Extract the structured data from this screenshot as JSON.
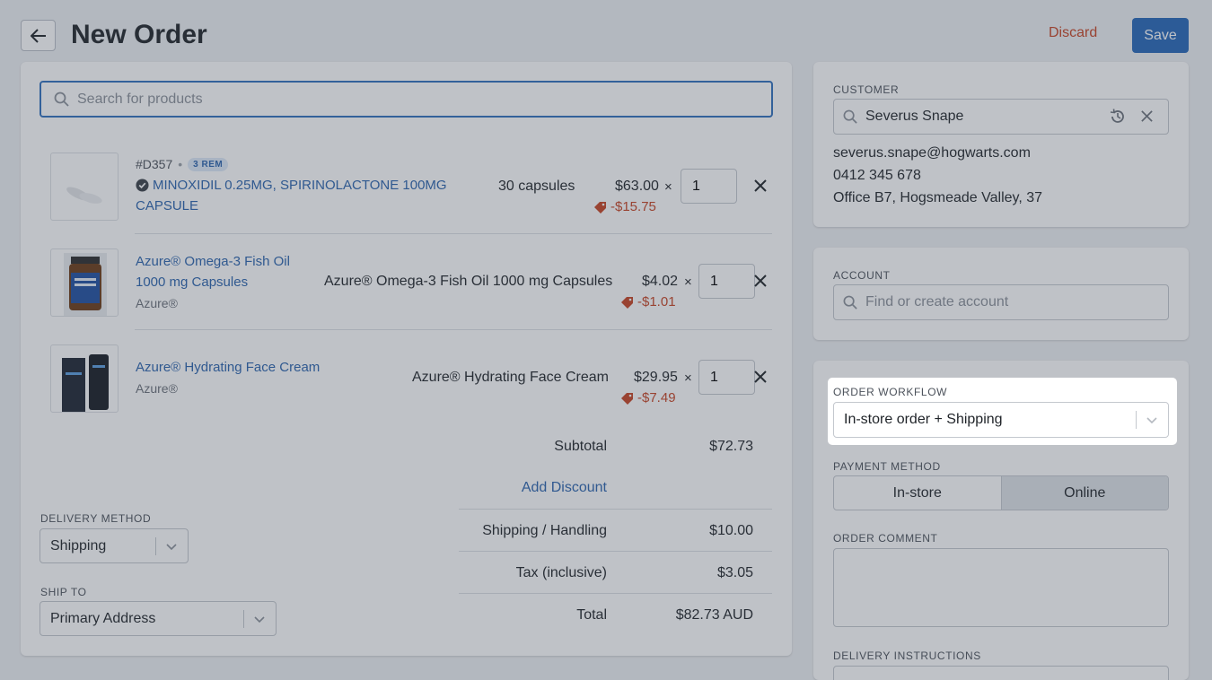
{
  "header": {
    "title": "New Order",
    "discard_label": "Discard",
    "save_label": "Save"
  },
  "search": {
    "placeholder": "Search for products"
  },
  "line_items": [
    {
      "sku": "#D357",
      "badge": "3 REM",
      "verified": true,
      "name_line1": "MINOXIDIL 0.25MG, SPIRINOLACTONE 100MG",
      "name_line2": "CAPSULE",
      "variant": "30 capsules",
      "price": "$63.00",
      "times": "×",
      "discount": "-$15.75",
      "qty": "1"
    },
    {
      "name_line1": "Azure® Omega-3 Fish Oil",
      "name_line2": "1000 mg Capsules",
      "brand": "Azure®",
      "variant": "Azure® Omega-3 Fish Oil 1000 mg Capsules",
      "price": "$4.02",
      "times": "×",
      "discount": "-$1.01",
      "qty": "1"
    },
    {
      "name_line1": "Azure® Hydrating Face Cream",
      "brand": "Azure®",
      "variant": "Azure® Hydrating Face Cream",
      "price": "$29.95",
      "times": "×",
      "discount": "-$7.49",
      "qty": "1"
    }
  ],
  "totals": {
    "subtotal_label": "Subtotal",
    "subtotal": "$72.73",
    "add_discount": "Add Discount",
    "shipping_label": "Shipping / Handling",
    "shipping": "$10.00",
    "tax_label": "Tax (inclusive)",
    "tax": "$3.05",
    "total_label": "Total",
    "total": "$82.73 AUD"
  },
  "delivery": {
    "method_label": "DELIVERY METHOD",
    "method_value": "Shipping",
    "ship_to_label": "SHIP TO",
    "ship_to_value": "Primary Address"
  },
  "customer": {
    "label": "CUSTOMER",
    "name": "Severus Snape",
    "email": "severus.snape@hogwarts.com",
    "phone": "0412 345 678",
    "address": "Office B7, Hogsmeade Valley, 37"
  },
  "account": {
    "label": "ACCOUNT",
    "placeholder": "Find or create account"
  },
  "workflow": {
    "label": "ORDER WORKFLOW",
    "value": "In-store order + Shipping",
    "payment_label": "PAYMENT METHOD",
    "payment_options": [
      "In-store",
      "Online"
    ],
    "payment_selected": "Online",
    "comment_label": "ORDER COMMENT",
    "delivery_instructions_label": "DELIVERY INSTRUCTIONS"
  },
  "colors": {
    "primary": "#2466b8",
    "link": "#2a63ad",
    "danger": "#c64222",
    "overlay": "rgba(60,70,85,0.33)"
  },
  "icons": [
    "back-arrow-icon",
    "search-icon",
    "verified-check-icon",
    "price-tag-icon",
    "close-icon",
    "chevron-down-icon",
    "history-icon"
  ]
}
